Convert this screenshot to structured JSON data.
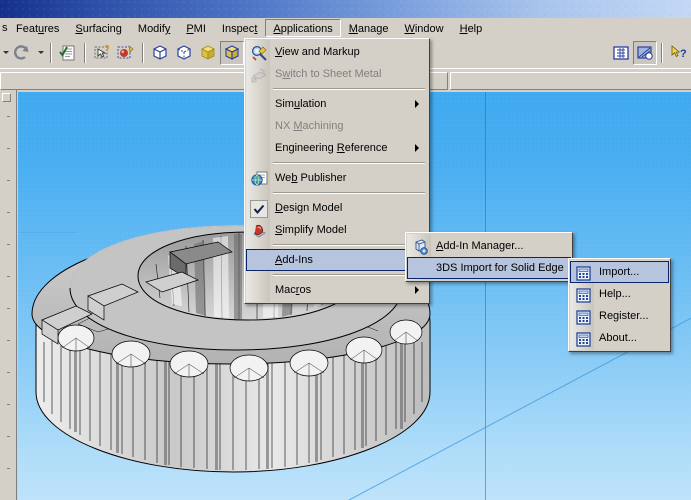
{
  "window": {
    "titlebar_visible": true
  },
  "menubar": {
    "clipped_left": "s",
    "items": [
      {
        "label": "Features",
        "mnemonic_index": 4,
        "active": false,
        "name": "menu-features"
      },
      {
        "label": "Surfacing",
        "mnemonic_index": 0,
        "active": false,
        "name": "menu-surfacing"
      },
      {
        "label": "Modify",
        "mnemonic_index": 5,
        "active": false,
        "name": "menu-modify"
      },
      {
        "label": "PMI",
        "mnemonic_index": 0,
        "active": false,
        "name": "menu-pmi"
      },
      {
        "label": "Inspect",
        "mnemonic_index": 6,
        "active": false,
        "name": "menu-inspect"
      },
      {
        "label": "Applications",
        "mnemonic_index": 0,
        "active": true,
        "name": "menu-applications"
      },
      {
        "label": "Manage",
        "mnemonic_index": 0,
        "active": false,
        "name": "menu-manage"
      },
      {
        "label": "Window",
        "mnemonic_index": 0,
        "active": false,
        "name": "menu-window"
      },
      {
        "label": "Help",
        "mnemonic_index": 0,
        "active": false,
        "name": "menu-help"
      }
    ]
  },
  "toolbar": {
    "buttons": [
      {
        "name": "undo-dropdown-arrow",
        "icon": "chevron-down-icon",
        "type": "arrow"
      },
      {
        "name": "redo-button",
        "icon": "redo-arrow-icon",
        "type": "icon"
      },
      {
        "name": "redo-dropdown-arrow",
        "icon": "chevron-down-icon",
        "type": "arrow"
      },
      {
        "name": "separator-1",
        "type": "sep"
      },
      {
        "name": "properties-button",
        "icon": "document-properties-icon",
        "type": "icon"
      },
      {
        "name": "separator-2",
        "type": "sep"
      },
      {
        "name": "select-tool-button",
        "icon": "select-arrow-icon",
        "type": "icon"
      },
      {
        "name": "paint-tool-button",
        "icon": "paint-sphere-icon",
        "type": "icon"
      },
      {
        "name": "separator-3",
        "type": "sep"
      },
      {
        "name": "shaded-view-button",
        "icon": "cube-wireframe-icon",
        "type": "icon"
      },
      {
        "name": "hidden-edge-view-button",
        "icon": "cube-hidden-edge-icon",
        "type": "icon"
      },
      {
        "name": "shaded-solid-button",
        "icon": "cube-solid-yellow-icon",
        "type": "icon"
      },
      {
        "name": "shaded-edges-button",
        "icon": "cube-shaded-edges-icon",
        "type": "icon",
        "pressed": true
      },
      {
        "name": "visible-edges-button",
        "icon": "cube-visible-edges-icon",
        "type": "icon"
      }
    ],
    "right_buttons": [
      {
        "name": "fit-view-button",
        "icon": "fit-frame-icon",
        "type": "icon"
      },
      {
        "name": "render-view-button",
        "icon": "render-shade-icon",
        "type": "icon",
        "pressed": true
      },
      {
        "name": "separator-4",
        "type": "sep"
      },
      {
        "name": "help-pointer-button",
        "icon": "help-arrow-question-icon",
        "type": "icon"
      }
    ]
  },
  "menus": {
    "applications": {
      "name": "applications-dropdown",
      "items": [
        {
          "label": "View and Markup",
          "mnemonic": "V",
          "icon": "view-markup-icon",
          "type": "item",
          "name": "menu-item-view-and-markup"
        },
        {
          "label": "Switch to Sheet Metal",
          "mnemonic": "w",
          "icon": "sheet-metal-icon",
          "type": "item",
          "disabled": true,
          "name": "menu-item-switch-to-sheet-metal"
        },
        {
          "type": "separator",
          "name": "menu-separator-1"
        },
        {
          "label": "Simulation",
          "mnemonic": "u",
          "type": "submenu",
          "name": "menu-item-simulation"
        },
        {
          "label": "NX Machining",
          "mnemonic": "M",
          "type": "item",
          "disabled": true,
          "name": "menu-item-nx-machining"
        },
        {
          "label": "Engineering Reference",
          "mnemonic": "R",
          "type": "submenu",
          "name": "menu-item-engineering-reference"
        },
        {
          "type": "separator",
          "name": "menu-separator-2"
        },
        {
          "label": "Web Publisher",
          "mnemonic": "b",
          "icon": "web-publisher-icon",
          "type": "item",
          "name": "menu-item-web-publisher"
        },
        {
          "type": "separator",
          "name": "menu-separator-3"
        },
        {
          "label": "Design Model",
          "mnemonic": "D",
          "icon": "checkmark-icon",
          "checked": true,
          "type": "item",
          "name": "menu-item-design-model"
        },
        {
          "label": "Simplify Model",
          "mnemonic": "S",
          "icon": "simplify-model-icon",
          "type": "item",
          "name": "menu-item-simplify-model"
        },
        {
          "type": "separator",
          "name": "menu-separator-4"
        },
        {
          "label": "Add-Ins",
          "mnemonic": "A",
          "type": "submenu",
          "selected": true,
          "name": "menu-item-add-ins"
        },
        {
          "type": "separator",
          "name": "menu-separator-5"
        },
        {
          "label": "Macros",
          "mnemonic": "r",
          "type": "submenu",
          "name": "menu-item-macros"
        }
      ]
    },
    "addins": {
      "name": "addins-submenu",
      "items": [
        {
          "label": "Add-In Manager...",
          "mnemonic": "A",
          "icon": "addin-manager-icon",
          "type": "item",
          "name": "menu-item-add-in-manager"
        },
        {
          "label": "3DS Import for Solid Edge",
          "type": "submenu",
          "selected": true,
          "name": "menu-item-3ds-import-for-solid-edge"
        }
      ]
    },
    "threeds": {
      "name": "3ds-import-submenu",
      "items": [
        {
          "label": "Import...",
          "icon": "calculator-grid-icon",
          "type": "item",
          "selected": true,
          "name": "menu-item-import"
        },
        {
          "label": "Help...",
          "icon": "calculator-grid-icon",
          "type": "item",
          "name": "menu-item-help"
        },
        {
          "label": "Register...",
          "icon": "calculator-grid-icon",
          "type": "item",
          "name": "menu-item-register"
        },
        {
          "label": "About...",
          "icon": "calculator-grid-icon",
          "type": "item",
          "name": "menu-item-about"
        }
      ]
    }
  },
  "viewport": {
    "name": "3d-viewport",
    "background_top_color": "#3fa9f0",
    "background_bottom_color": "#bee3fa",
    "model_name": "faceted-gear-ring-model",
    "model_fill": "#d8d8d8",
    "model_edge": "#000000"
  },
  "colors": {
    "window_chrome": "#d4d0c8",
    "menu_highlight_fill": "#b6c4dd",
    "menu_highlight_border": "#0a246a",
    "disabled_text": "#808080",
    "titlebar_start": "#14308c",
    "titlebar_end": "#c3d8f5"
  }
}
